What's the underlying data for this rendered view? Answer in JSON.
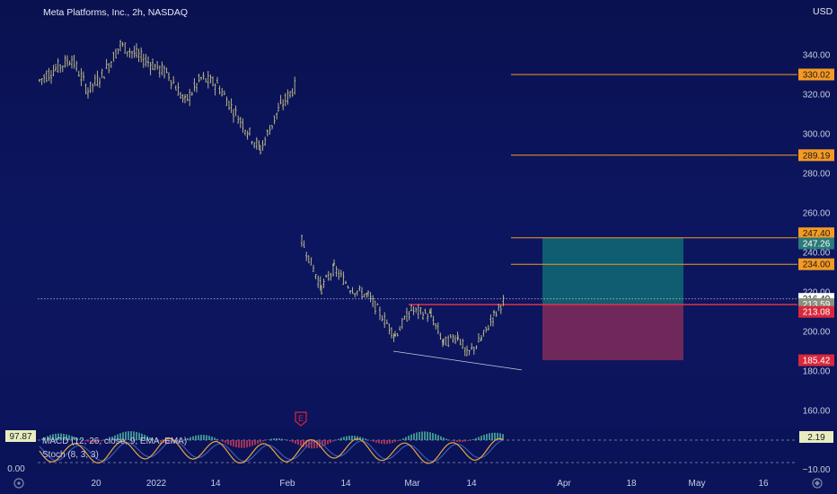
{
  "header": {
    "title": "Meta Platforms, Inc., 2h, NASDAQ",
    "currency": "USD"
  },
  "colors": {
    "background": "#0c1660",
    "price_line": "#f59a23",
    "candle": "#c8c28a",
    "profit_zone": "#0f6a73",
    "loss_zone": "#7a2a5a",
    "entry_line": "#e0314a",
    "last_price_tag": "#ffffff",
    "target_tag": "#2a7a7a",
    "stop_tag": "#d8283c",
    "macd_up": "#4ab0a0",
    "macd_down": "#c83a5a",
    "stoch_k": "#e8a640",
    "stoch_d": "#3a5ab0"
  },
  "chart_data": {
    "type": "line",
    "title": "Meta Platforms, Inc., 2h, NASDAQ",
    "xlabel": "",
    "ylabel": "USD",
    "ylim": [
      150,
      355
    ],
    "grid": false,
    "x_ticks": [
      "20",
      "2022",
      "14",
      "Feb",
      "14",
      "Mar",
      "14",
      "Apr",
      "18",
      "May",
      "16"
    ],
    "y_ticks": [
      "160.00",
      "180.00",
      "200.00",
      "220.00",
      "240.00",
      "260.00",
      "280.00",
      "300.00",
      "320.00",
      "340.00"
    ],
    "series": [
      {
        "name": "",
        "x": [
          "Dec 07",
          "Dec 10",
          "Dec 14",
          "Dec 17",
          "Dec 21",
          "Dec 24",
          "Dec 28",
          "Dec 31",
          "Jan 04",
          "Jan 07",
          "Jan 11",
          "Jan 14",
          "Jan 18",
          "Jan 21",
          "Jan 25",
          "Jan 28",
          "Feb 01",
          "Feb 03",
          "Feb 07",
          "Feb 10",
          "Feb 14",
          "Feb 17",
          "Feb 21",
          "Feb 24",
          "Feb 28",
          "Mar 03",
          "Mar 07",
          "Mar 10",
          "Mar 14",
          "Mar 17",
          "Mar 21"
        ],
        "values": [
          327,
          333,
          338,
          322,
          331,
          345,
          340,
          335,
          330,
          316,
          328,
          325,
          312,
          300,
          292,
          312,
          325,
          246,
          222,
          232,
          222,
          218,
          198,
          211,
          208,
          194,
          198,
          188,
          196,
          208,
          216.49
        ]
      }
    ],
    "levels": [
      {
        "label": "330.02",
        "value": 330.02,
        "role": "target"
      },
      {
        "label": "289.19",
        "value": 289.19,
        "role": "target"
      },
      {
        "label": "247.40",
        "value": 247.4,
        "role": "target"
      },
      {
        "label": "234.00",
        "value": 234.0,
        "role": "target"
      },
      {
        "label": "216.49",
        "value": 216.49,
        "role": "last-price"
      },
      {
        "label": "213.59",
        "value": 213.59,
        "role": "entry"
      },
      {
        "label": "213.08",
        "value": 213.08,
        "role": "entry"
      },
      {
        "label": "185.42",
        "value": 185.42,
        "role": "stop"
      },
      {
        "label": "247.26",
        "value": 247.26,
        "role": "take-profit"
      }
    ],
    "position": {
      "entry": 213.59,
      "take_profit": 247.26,
      "stop_loss": 185.42
    },
    "earnings_marker": "E"
  },
  "indicators": {
    "macd_label": "MACD (12, 26, close, 9, EMA, EMA)",
    "stoch_label": "Stoch (8, 3, 3)",
    "left_value_top": "97.87",
    "left_value_bottom": "0.00",
    "right_value_top": "2.19",
    "right_value_bottom": "−10.00"
  },
  "footer": {
    "left_icon": "settings-icon",
    "right_icon": "auto-scale-icon"
  }
}
